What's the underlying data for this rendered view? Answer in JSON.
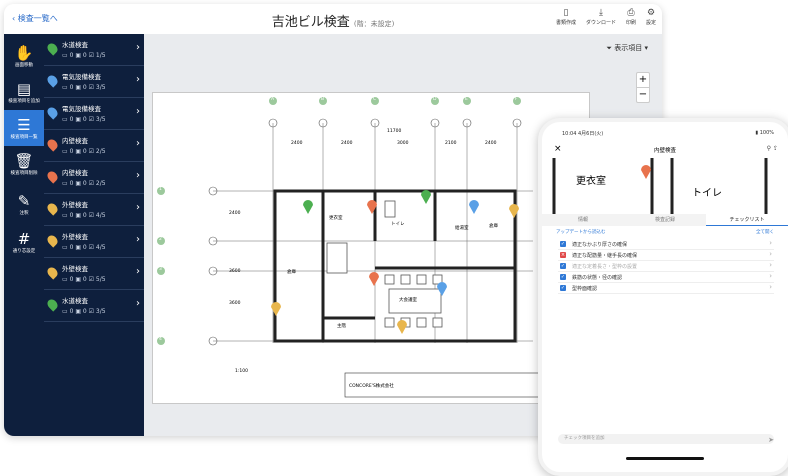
{
  "header": {
    "back_label": "検査一覧へ",
    "title": "吉池ビル検査",
    "title_suffix": "(階：未設定)",
    "actions": [
      {
        "label": "書類作成",
        "icon": "document-icon"
      },
      {
        "label": "ダウンロード",
        "icon": "download-icon"
      },
      {
        "label": "印刷",
        "icon": "print-icon"
      },
      {
        "label": "設定",
        "icon": "gear-icon"
      }
    ]
  },
  "rail": {
    "items": [
      {
        "label": "画面移動",
        "icon": "hand-icon",
        "active": false
      },
      {
        "label": "検査項目を追加",
        "icon": "add-item-icon",
        "active": false
      },
      {
        "label": "検査項目一覧",
        "icon": "pin-list-icon",
        "active": true
      },
      {
        "label": "検査項目削除",
        "icon": "trash-icon",
        "active": false
      },
      {
        "label": "注釈",
        "icon": "pen-icon",
        "active": false
      },
      {
        "label": "通り芯設定",
        "icon": "grid-icon",
        "active": false
      }
    ]
  },
  "inspection_list": [
    {
      "name": "水道検査",
      "color": "#4caf50",
      "comments": "0",
      "photos": "0",
      "progress": "1/5"
    },
    {
      "name": "電気設備検査",
      "color": "#5aa0e6",
      "comments": "0",
      "photos": "0",
      "progress": "3/5"
    },
    {
      "name": "電気設備検査",
      "color": "#5aa0e6",
      "comments": "0",
      "photos": "0",
      "progress": "3/5"
    },
    {
      "name": "内壁検査",
      "color": "#e8734d",
      "comments": "0",
      "photos": "0",
      "progress": "2/5"
    },
    {
      "name": "内壁検査",
      "color": "#e8734d",
      "comments": "0",
      "photos": "0",
      "progress": "2/5"
    },
    {
      "name": "外壁検査",
      "color": "#e8b64d",
      "comments": "0",
      "photos": "0",
      "progress": "4/5"
    },
    {
      "name": "外壁検査",
      "color": "#e8b64d",
      "comments": "0",
      "photos": "0",
      "progress": "4/5"
    },
    {
      "name": "外壁検査",
      "color": "#e8b64d",
      "comments": "0",
      "photos": "0",
      "progress": "5/5"
    },
    {
      "name": "水道検査",
      "color": "#4caf50",
      "comments": "0",
      "photos": "0",
      "progress": "3/5"
    }
  ],
  "canvas": {
    "filter_label": "表示項目",
    "zoom_in": "+",
    "zoom_out": "−",
    "plan": {
      "grid_top": [
        "A",
        "B",
        "C",
        "D",
        "E",
        "F"
      ],
      "grid_left": [
        "1",
        "2",
        "3",
        "4"
      ],
      "dimensions": [
        "11700",
        "2400",
        "2400",
        "3000",
        "2100",
        "2400",
        "2400",
        "3600",
        "3600"
      ],
      "rooms": [
        "更衣室",
        "トイレ",
        "倉庫",
        "大会議室",
        "主階",
        "給湯室",
        "倉庫"
      ],
      "title_block": "CONCORE'S株式会社",
      "scale": "1:100"
    }
  },
  "phone": {
    "time": "10:04 4月6日(火)",
    "battery": "100%",
    "title": "内壁検査",
    "close": "×",
    "plan_rooms": [
      "更衣室",
      "トイレ"
    ],
    "tabs": [
      "情報",
      "検査記録",
      "チェックリスト"
    ],
    "active_tab": 2,
    "sub_left": "アップデートから読込む",
    "sub_right": "全て開く",
    "checklist": [
      {
        "text": "適正なかぶり厚さの確保",
        "status": "checked"
      },
      {
        "text": "適正な配筋量・継手長の確保",
        "status": "error"
      },
      {
        "text": "適正な定着長さ・型枠の設置",
        "status": "checked"
      },
      {
        "text": "鉄筋の状態・径の確認",
        "status": "checked"
      },
      {
        "text": "型枠面確認",
        "status": "checked"
      }
    ],
    "input_placeholder": "チェック項目を追加"
  }
}
